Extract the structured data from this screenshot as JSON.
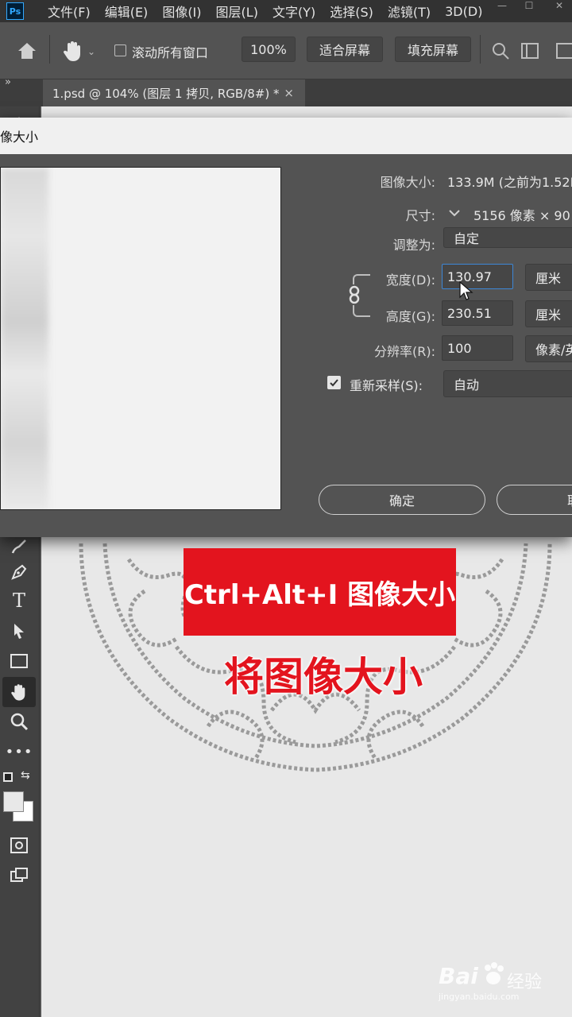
{
  "menubar": {
    "logo": "Ps",
    "items": [
      "文件(F)",
      "编辑(E)",
      "图像(I)",
      "图层(L)",
      "文字(Y)",
      "选择(S)",
      "滤镜(T)",
      "3D(D)"
    ]
  },
  "options": {
    "scroll_all_windows": "滚动所有窗口",
    "zoom_value": "100%",
    "fit_screen": "适合屏幕",
    "fill_screen": "填充屏幕"
  },
  "document": {
    "tab_title": "1.psd @ 104% (图层 1 拷贝, RGB/8#) *",
    "tab_close": "×"
  },
  "dialog": {
    "title": "像大小",
    "image_size_label": "图像大小:",
    "image_size_value": "133.9M (之前为1.52M",
    "dimensions_label": "尺寸:",
    "dimensions_value": "5156 像素  ×  90",
    "fit_to_label": "调整为:",
    "fit_to_value": "自定",
    "width_label": "宽度(D):",
    "width_value": "130.97",
    "width_unit": "厘米",
    "height_label": "高度(G):",
    "height_value": "230.51",
    "height_unit": "厘米",
    "resolution_label": "分辨率(R):",
    "resolution_value": "100",
    "resolution_unit": "像素/英",
    "resample_label": "重新采样(S):",
    "resample_value": "自动",
    "ok_button": "确定",
    "cancel_button": "取"
  },
  "caption": {
    "box_text": "Ctrl+Alt+I 图像大小",
    "sub_text": "将图像大小"
  },
  "watermark": {
    "brand": "Bai",
    "brand_cn": "经验",
    "url": "jingyan.baidu.com"
  },
  "colors": {
    "accent": "#3d87d6",
    "caption_red": "#e3141e",
    "panel": "#535353"
  }
}
